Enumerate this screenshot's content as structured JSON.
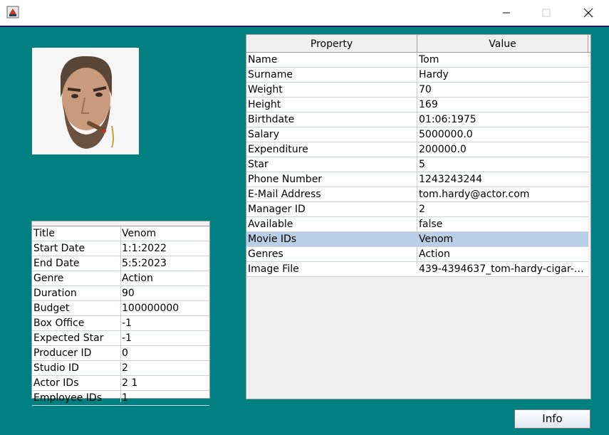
{
  "window": {
    "title": "",
    "icon": "java-app-icon"
  },
  "actor": {
    "portrait": "tom-hardy-portrait",
    "headers": {
      "property": "Property",
      "value": "Value"
    },
    "rows": [
      {
        "property": "Name",
        "value": "Tom"
      },
      {
        "property": "Surname",
        "value": "Hardy"
      },
      {
        "property": "Weight",
        "value": "70"
      },
      {
        "property": "Height",
        "value": "169"
      },
      {
        "property": "Birthdate",
        "value": "01:06:1975"
      },
      {
        "property": "Salary",
        "value": "5000000.0"
      },
      {
        "property": "Expenditure",
        "value": "200000.0"
      },
      {
        "property": "Star",
        "value": "5"
      },
      {
        "property": "Phone Number",
        "value": "1243243244"
      },
      {
        "property": "E-Mail Address",
        "value": "tom.hardy@actor.com"
      },
      {
        "property": "Manager ID",
        "value": "2"
      },
      {
        "property": "Available",
        "value": "false"
      },
      {
        "property": "Movie IDs",
        "value": "Venom"
      },
      {
        "property": "Genres",
        "value": "Action"
      },
      {
        "property": "Image File",
        "value": "439-4394637_tom-hardy-cigar-tom-..."
      }
    ],
    "selected_row": 12
  },
  "movie": {
    "rows": [
      {
        "property": "Title",
        "value": "Venom"
      },
      {
        "property": "Start Date",
        "value": "1:1:2022"
      },
      {
        "property": "End Date",
        "value": "5:5:2023"
      },
      {
        "property": "Genre",
        "value": "Action"
      },
      {
        "property": "Duration",
        "value": "90"
      },
      {
        "property": "Budget",
        "value": "100000000"
      },
      {
        "property": "Box Office",
        "value": "-1"
      },
      {
        "property": "Expected Star",
        "value": "-1"
      },
      {
        "property": "Producer ID",
        "value": "0"
      },
      {
        "property": "Studio ID",
        "value": "2"
      },
      {
        "property": "Actor IDs",
        "value": "2 1"
      },
      {
        "property": "Employee IDs",
        "value": "1"
      }
    ]
  },
  "buttons": {
    "info_label": "Info"
  },
  "colors": {
    "background": "#008080",
    "selection": "#b8cfe5"
  }
}
